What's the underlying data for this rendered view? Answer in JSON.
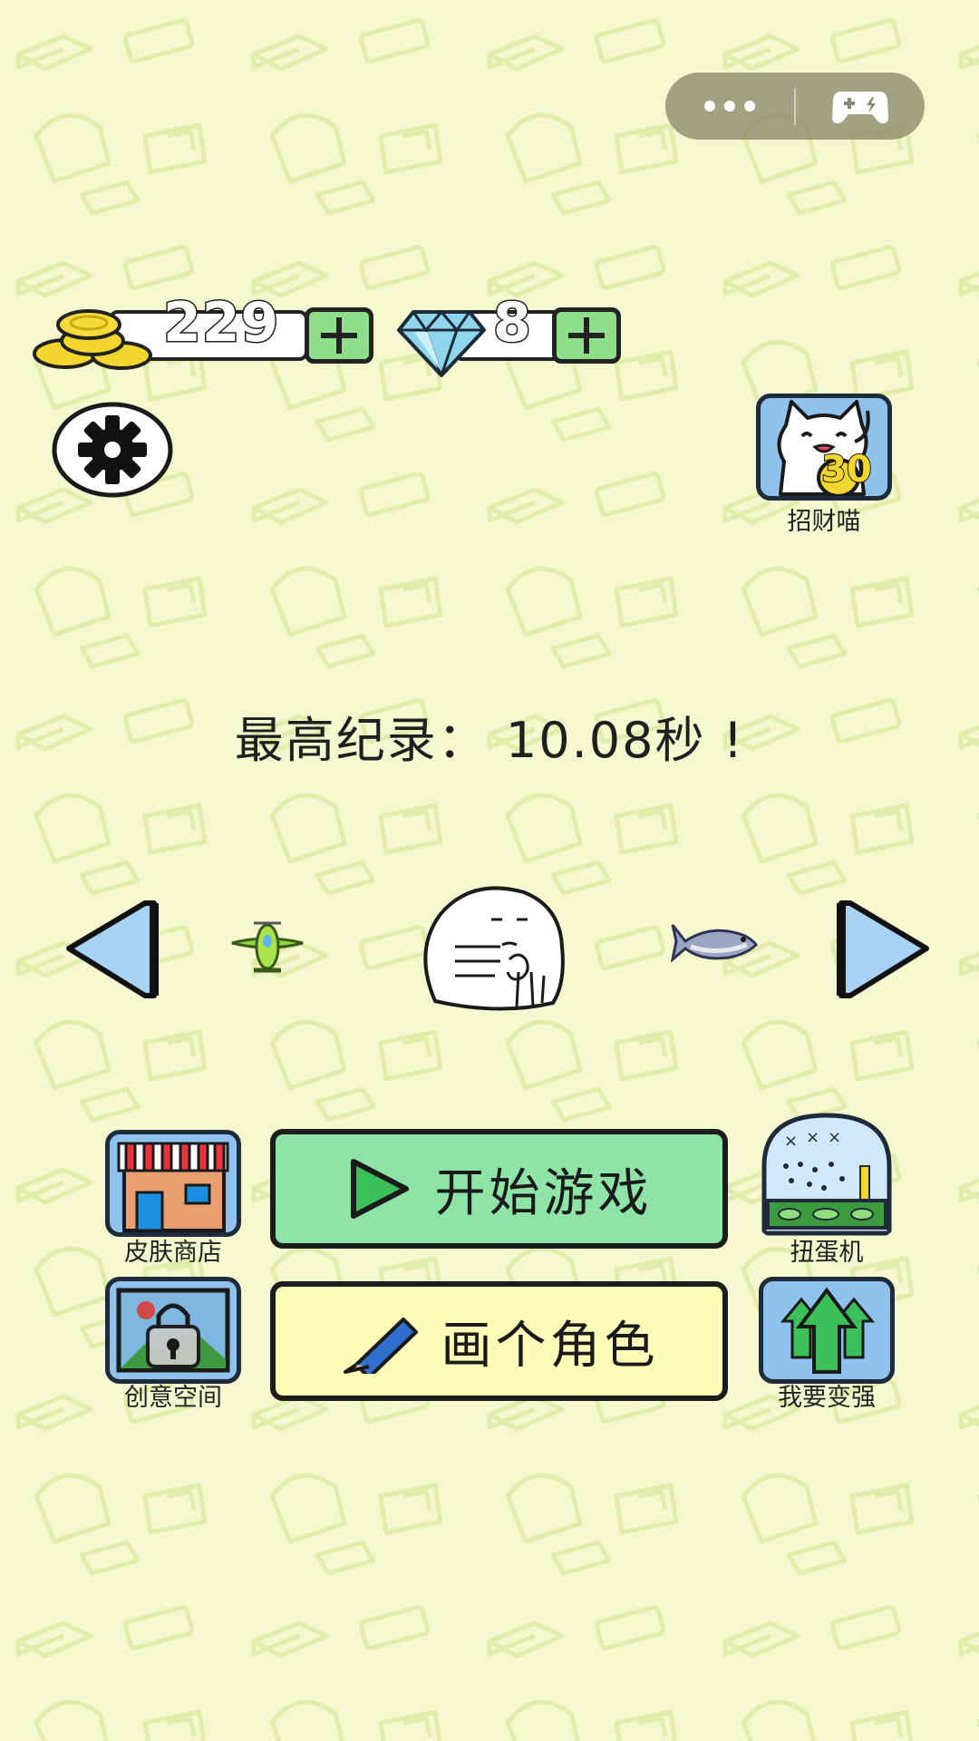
{
  "currency": {
    "coins": "229",
    "diamonds": "8"
  },
  "record": {
    "text": "最高纪录： 10.08秒 !"
  },
  "side": {
    "lucky_cat_label": "招财喵",
    "lucky_cat_badge": "30",
    "skin_shop_label": "皮肤商店",
    "creative_space_label": "创意空间",
    "gacha_label": "扭蛋机",
    "power_up_label": "我要变强"
  },
  "buttons": {
    "start_label": "开始游戏",
    "draw_label": "画个角色"
  },
  "colors": {
    "background": "#f5f8cf",
    "start_button": "#8ee4a6",
    "draw_button": "#fdfbb8",
    "tile": "#8fc3ee",
    "plus_button": "#8fdf8a"
  },
  "icons": [
    "more-icon",
    "gamepad-icon",
    "coin-stack-icon",
    "diamond-icon",
    "plus-icon",
    "settings-gear-icon",
    "lucky-cat-icon",
    "arrow-left-icon",
    "arrow-right-icon",
    "plane-icon",
    "fish-icon",
    "play-icon",
    "pencil-icon",
    "shop-icon",
    "gacha-machine-icon",
    "lock-image-icon",
    "trees-upgrade-icon"
  ]
}
